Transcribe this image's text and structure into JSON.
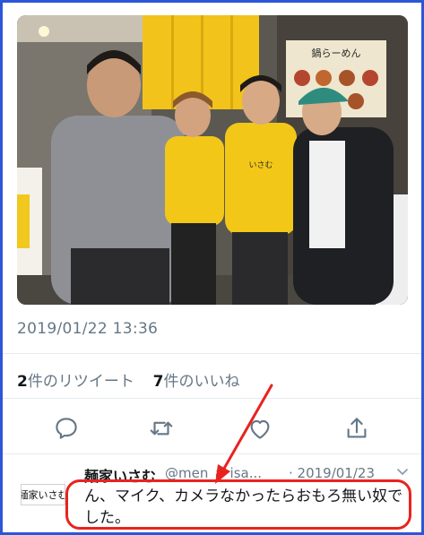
{
  "tweet": {
    "timestamp": "2019/01/22 13:36",
    "retweet_count": "2",
    "retweet_label": "件のリツイート",
    "like_count": "7",
    "like_label": "件のいいね"
  },
  "photo": {
    "sign_text": "鍋らーめん",
    "shirt_text": "いさむ"
  },
  "actions": [
    {
      "icon": "reply-icon"
    },
    {
      "icon": "retweet-icon"
    },
    {
      "icon": "like-icon"
    },
    {
      "icon": "share-icon"
    }
  ],
  "reply": {
    "author_name": "麺家いさむ",
    "handle": "@men_a_isa...",
    "date": "· 2019/01/23",
    "text": "ん、マイク、カメラなかったらおもろ無い奴でした。",
    "avatar_text": "麺家いさむ"
  },
  "colors": {
    "frame_border": "#2c55d8",
    "annotation_red": "#e8231f",
    "meta_gray": "#657786"
  }
}
